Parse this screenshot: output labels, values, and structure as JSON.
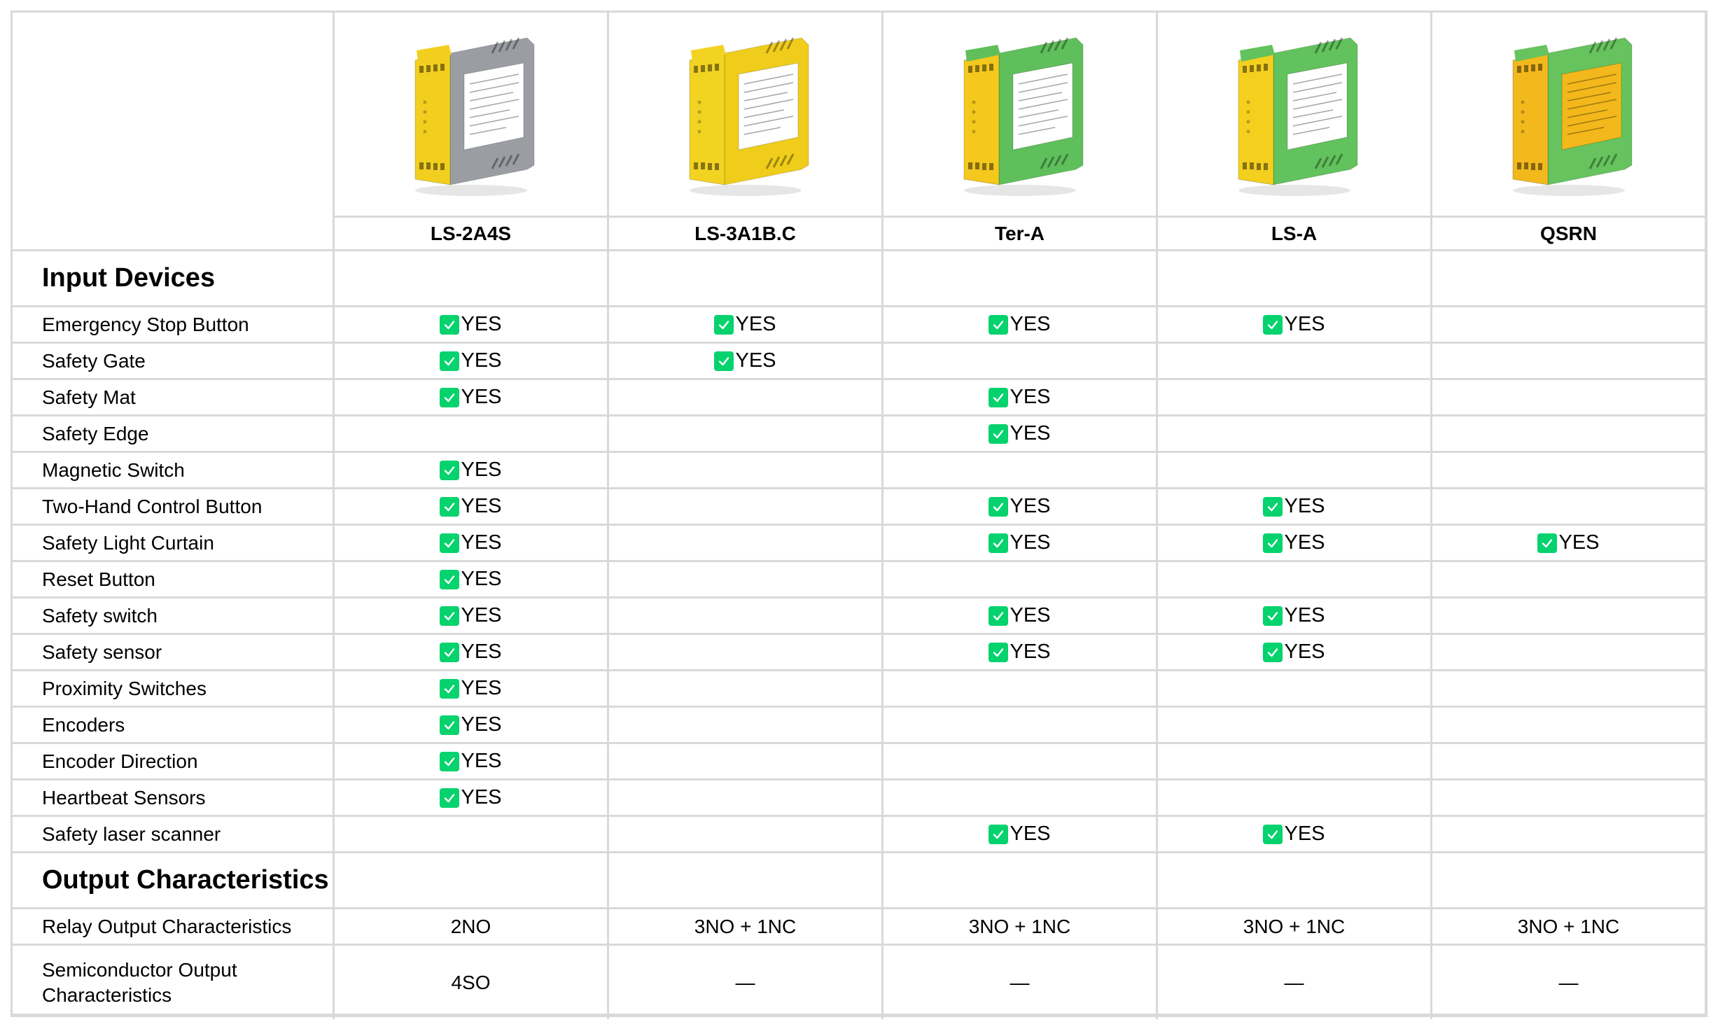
{
  "products": [
    {
      "name": "LS-2A4S",
      "image": "yellow-grey-safety-relay",
      "body_color": "#f2cf1f",
      "side_color": "#9a9ea3",
      "front_color": "#f2cf1f"
    },
    {
      "name": "LS-3A1B.C",
      "image": "yellow-safety-relay",
      "body_color": "#f3d321",
      "side_color": "#f0cd1b",
      "front_color": "#f3d321"
    },
    {
      "name": "Ter-A",
      "image": "green-safety-relay",
      "body_color": "#5fbf5b",
      "side_color": "#5fbf5b",
      "front_color": "#f4c81c"
    },
    {
      "name": "LS-A",
      "image": "green-safety-relay",
      "body_color": "#62c25d",
      "side_color": "#62c25d",
      "front_color": "#f4d01e"
    },
    {
      "name": "QSRN",
      "image": "green-orange-safety-relay",
      "body_color": "#66c35e",
      "side_color": "#66c35e",
      "front_color": "#f2b81c"
    }
  ],
  "colors": {
    "check_green": "#06d26e",
    "border": "#d9d9d9"
  },
  "yes_label": "YES",
  "sections": [
    {
      "title": "Input Devices",
      "rows": [
        {
          "label": "Emergency Stop Button",
          "values": [
            "YES",
            "YES",
            "YES",
            "YES",
            ""
          ]
        },
        {
          "label": "Safety Gate",
          "values": [
            "YES",
            "YES",
            "",
            "",
            ""
          ]
        },
        {
          "label": "Safety Mat",
          "values": [
            "YES",
            "",
            "YES",
            "",
            ""
          ]
        },
        {
          "label": "Safety Edge",
          "values": [
            "",
            "",
            "YES",
            "",
            ""
          ]
        },
        {
          "label": "Magnetic Switch",
          "values": [
            "YES",
            "",
            "",
            "",
            ""
          ]
        },
        {
          "label": "Two-Hand Control Button",
          "values": [
            "YES",
            "",
            "YES",
            "YES",
            ""
          ]
        },
        {
          "label": "Safety Light Curtain",
          "values": [
            "YES",
            "",
            "YES",
            "YES",
            "YES"
          ]
        },
        {
          "label": "Reset Button",
          "values": [
            "YES",
            "",
            "",
            "",
            ""
          ]
        },
        {
          "label": "Safety switch",
          "values": [
            "YES",
            "",
            "YES",
            "YES",
            ""
          ]
        },
        {
          "label": "Safety sensor",
          "values": [
            "YES",
            "",
            "YES",
            "YES",
            ""
          ]
        },
        {
          "label": "Proximity Switches",
          "values": [
            "YES",
            "",
            "",
            "",
            ""
          ]
        },
        {
          "label": "Encoders",
          "values": [
            "YES",
            "",
            "",
            "",
            ""
          ]
        },
        {
          "label": "Encoder Direction",
          "values": [
            "YES",
            "",
            "",
            "",
            ""
          ]
        },
        {
          "label": "Heartbeat Sensors",
          "values": [
            "YES",
            "",
            "",
            "",
            ""
          ]
        },
        {
          "label": "Safety laser scanner",
          "values": [
            "",
            "",
            "YES",
            "YES",
            ""
          ]
        }
      ]
    },
    {
      "title": "Output Characteristics",
      "rows": [
        {
          "label": "Relay Output Characteristics",
          "values": [
            "2NO",
            "3NO + 1NC",
            "3NO + 1NC",
            "3NO + 1NC",
            "3NO + 1NC"
          ]
        },
        {
          "label": "Semiconductor Output\nCharacteristics",
          "values": [
            "4SO",
            "—",
            "—",
            "—",
            "—"
          ],
          "tall": true
        }
      ]
    }
  ]
}
